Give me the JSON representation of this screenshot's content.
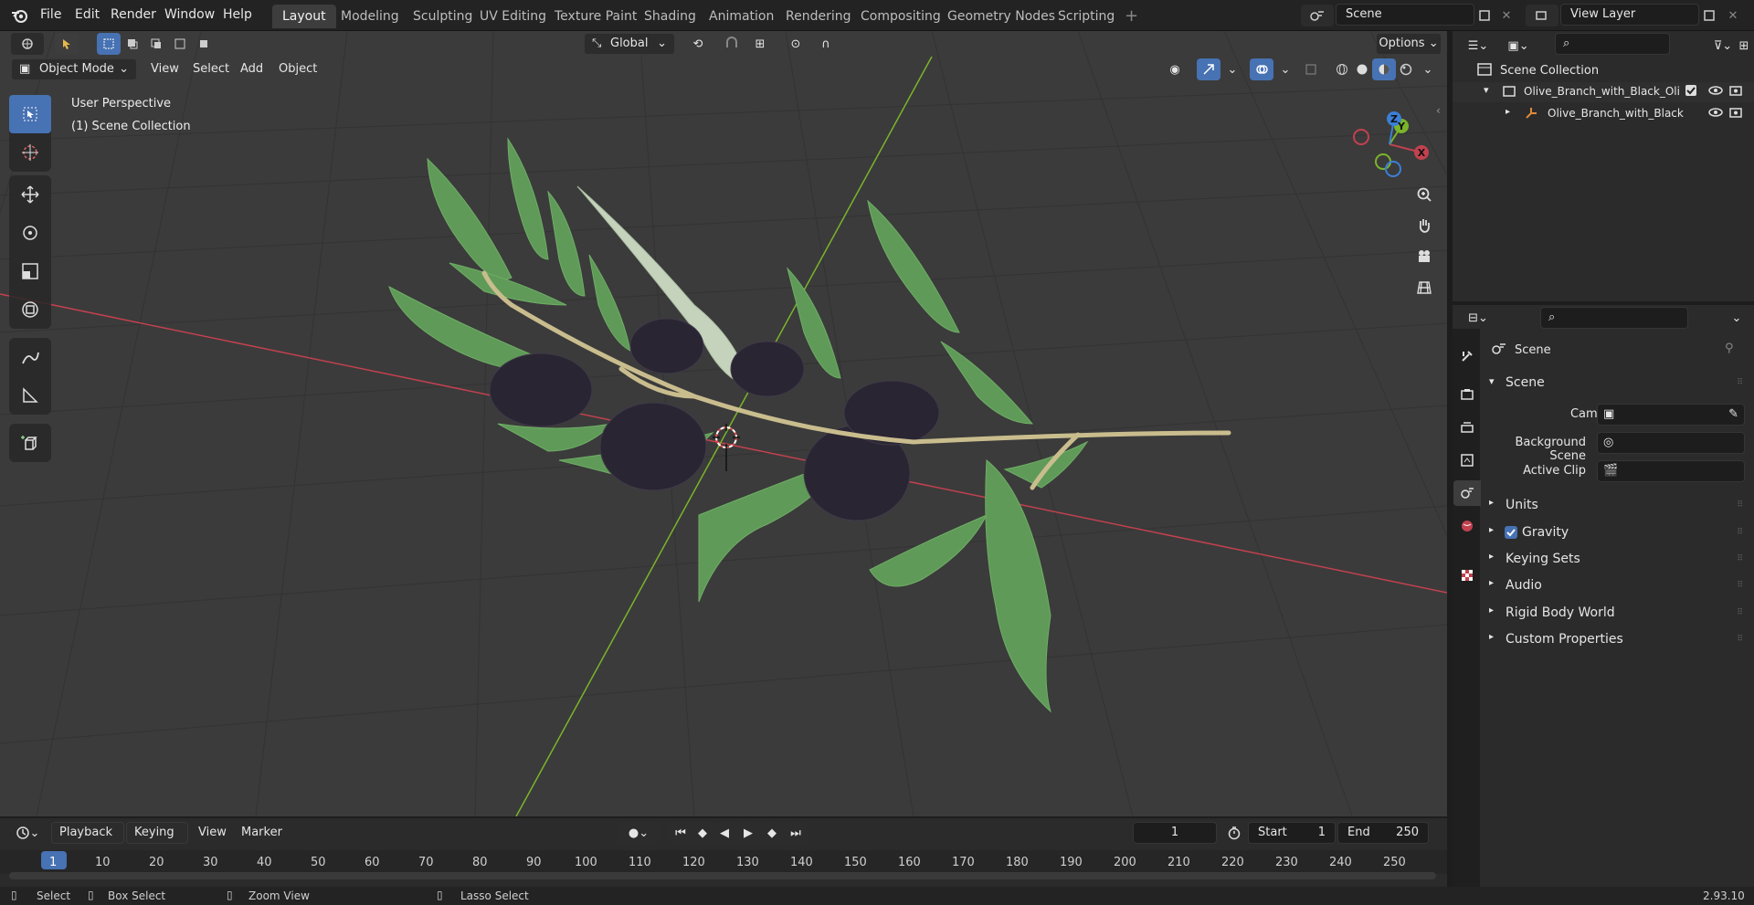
{
  "top_menu": {
    "items": [
      "File",
      "Edit",
      "Render",
      "Window",
      "Help"
    ],
    "workspace_tabs": [
      "Layout",
      "Modeling",
      "Sculpting",
      "UV Editing",
      "Texture Paint",
      "Shading",
      "Animation",
      "Rendering",
      "Compositing",
      "Geometry Nodes",
      "Scripting"
    ],
    "active_tab": "Layout",
    "scene_name": "Scene",
    "view_layer": "View Layer"
  },
  "viewport_header": {
    "transform_orientation": "Global",
    "options_label": "Options",
    "mode": "Object Mode",
    "menus": [
      "View",
      "Select",
      "Add",
      "Object"
    ]
  },
  "viewport": {
    "perspective_label": "User Perspective",
    "collection_label": "(1) Scene Collection",
    "gizmo_axes": [
      "X",
      "Y",
      "Z"
    ],
    "colors": {
      "x_axis": "#c2414f",
      "y_axis": "#7bb42a",
      "z_axis": "#3b7fd6",
      "grid_bg": "#3b3b3b"
    }
  },
  "outliner": {
    "root": "Scene Collection",
    "items": [
      {
        "label": "Olive_Branch_with_Black_Oli",
        "type": "collection"
      },
      {
        "label": "Olive_Branch_with_Black",
        "type": "object"
      }
    ]
  },
  "properties": {
    "context_title": "Scene",
    "panel_title": "Scene",
    "fields": [
      {
        "label": "Camera",
        "value": ""
      },
      {
        "label": "Background Scene",
        "value": ""
      },
      {
        "label": "Active Clip",
        "value": ""
      }
    ],
    "subpanels": [
      "Units",
      "Gravity",
      "Keying Sets",
      "Audio",
      "Rigid Body World",
      "Custom Properties"
    ],
    "gravity_checked": true
  },
  "timeline": {
    "menus": [
      "Playback",
      "Keying",
      "View",
      "Marker"
    ],
    "current_frame": "1",
    "start_label": "Start",
    "start_value": "1",
    "end_label": "End",
    "end_value": "250",
    "ruler": [
      "1",
      "10",
      "20",
      "30",
      "40",
      "50",
      "60",
      "70",
      "80",
      "90",
      "100",
      "110",
      "120",
      "130",
      "140",
      "150",
      "160",
      "170",
      "180",
      "190",
      "200",
      "210",
      "220",
      "230",
      "240",
      "250"
    ]
  },
  "status_bar": {
    "items": [
      "Select",
      "Box Select",
      "Zoom View",
      "Lasso Select"
    ],
    "version": "2.93.10"
  }
}
